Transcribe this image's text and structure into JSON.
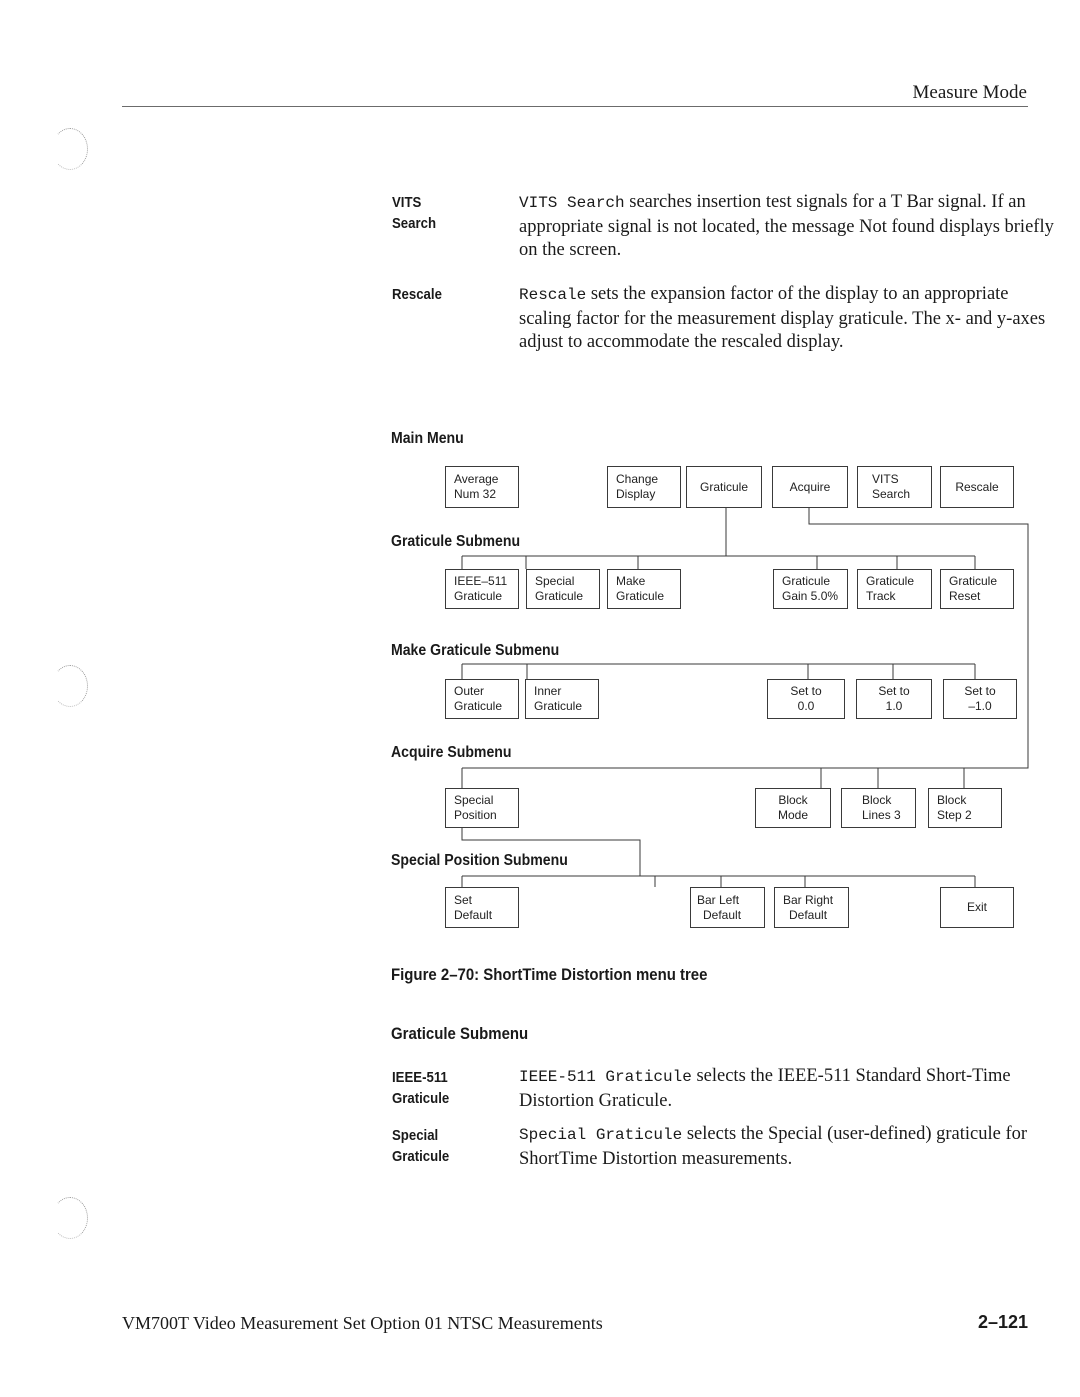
{
  "header": {
    "title": "Measure Mode"
  },
  "definitions_top": [
    {
      "term_lines": [
        "VITS",
        "Search"
      ],
      "code": "VITS Search",
      "text": " searches insertion test signals for a T Bar signal. If an appropriate signal is not located, the message Not found displays briefly on the screen."
    },
    {
      "term_lines": [
        "Rescale"
      ],
      "code": "Rescale",
      "text": " sets the expansion factor of the display to an appropriate scaling factor for the measurement display graticule. The x- and y-axes adjust to accommodate the rescaled display."
    }
  ],
  "menu_tree": {
    "main_menu": {
      "label": "Main Menu",
      "buttons": [
        [
          "Average",
          "Num  32"
        ],
        [
          "Change",
          "Display"
        ],
        [
          "Graticule"
        ],
        [
          "Acquire"
        ],
        [
          "VITS",
          "Search"
        ],
        [
          "Rescale"
        ]
      ]
    },
    "graticule_submenu": {
      "label": "Graticule Submenu",
      "buttons": [
        [
          "IEEE–511",
          "Graticule"
        ],
        [
          "Special",
          "Graticule"
        ],
        [
          "Make",
          "Graticule"
        ],
        [
          "Graticule",
          "Gain 5.0%"
        ],
        [
          "Graticule",
          "Track"
        ],
        [
          "Graticule",
          "Reset"
        ]
      ]
    },
    "make_graticule_submenu": {
      "label": "Make Graticule Submenu",
      "buttons": [
        [
          "Outer",
          "Graticule"
        ],
        [
          "Inner",
          "Graticule"
        ],
        [
          "Set to",
          "0.0"
        ],
        [
          "Set to",
          "1.0"
        ],
        [
          "Set to",
          "–1.0"
        ]
      ]
    },
    "acquire_submenu": {
      "label": "Acquire Submenu",
      "buttons": [
        [
          "Special",
          "Position"
        ],
        [
          "Block",
          "Mode"
        ],
        [
          "Block",
          "Lines  3"
        ],
        [
          "Block",
          "Step  2"
        ]
      ]
    },
    "special_position_submenu": {
      "label": "Special Position  Submenu",
      "buttons": [
        [
          "Set",
          "Default"
        ],
        [
          "Bar Left",
          "Default"
        ],
        [
          "Bar Right",
          "Default"
        ],
        [
          "Exit"
        ]
      ]
    }
  },
  "figure_caption": "Figure 2–70: ShortTime Distortion menu tree",
  "graticule_section": {
    "heading": "Graticule Submenu",
    "definitions": [
      {
        "term_lines": [
          "IEEE-511",
          "Graticule"
        ],
        "code": "IEEE-511 Graticule",
        "text": " selects the IEEE-511 Standard Short-Time Distortion Graticule."
      },
      {
        "term_lines": [
          "Special",
          "Graticule"
        ],
        "code": "Special Graticule",
        "text": " selects the Special (user-defined) graticule for ShortTime Distortion measurements."
      }
    ]
  },
  "footer": {
    "title": "VM700T Video Measurement Set Option 01 NTSC Measurements",
    "page_number": "2–121"
  }
}
